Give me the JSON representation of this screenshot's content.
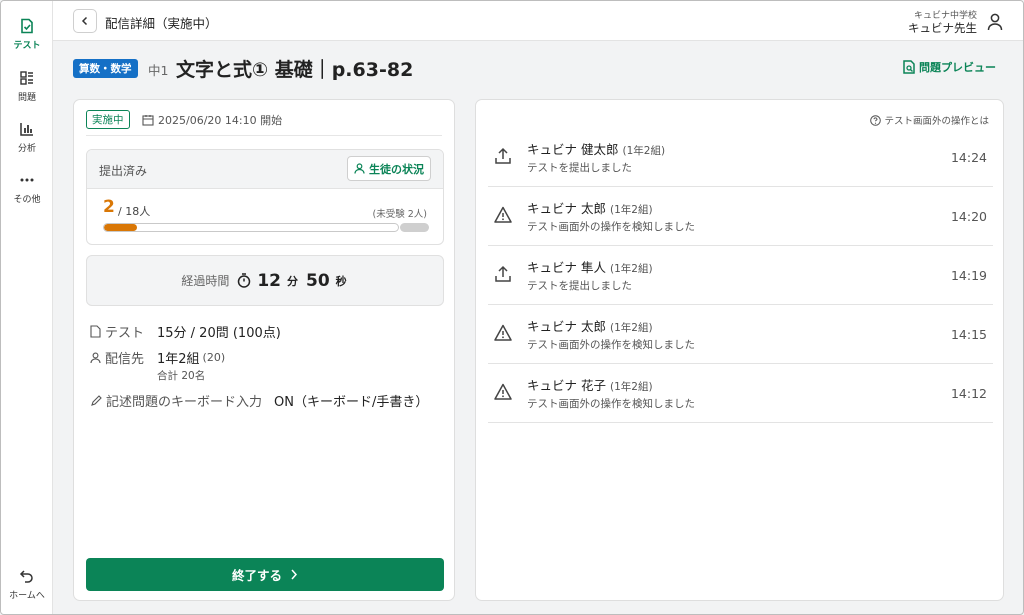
{
  "sidebar": {
    "items": [
      {
        "label": "テスト",
        "icon": "test-doc-icon",
        "active": true
      },
      {
        "label": "問題",
        "icon": "question-list-icon",
        "active": false
      },
      {
        "label": "分析",
        "icon": "bar-chart-icon",
        "active": false
      },
      {
        "label": "その他",
        "icon": "more-dots-icon",
        "active": false
      }
    ],
    "home_label": "ホームへ"
  },
  "header": {
    "title": "配信詳細（実施中）",
    "school": "キュビナ中学校",
    "teacher": "キュビナ先生"
  },
  "page": {
    "subject_badge": "算数・数学",
    "grade": "中1",
    "title": "文字と式① 基礎｜p.63-82",
    "preview_label": "問題プレビュー"
  },
  "left_card": {
    "status_badge": "実施中",
    "date": "2025/06/20 14:10 開始",
    "submitted_label": "提出済み",
    "student_status_label": "生徒の状況",
    "submitted_count": "2",
    "total_label": "/ 18人",
    "pending_label": "(未受験 2人)",
    "progress_fraction": 0.111,
    "elapsed_label": "経過時間",
    "elapsed_min": "12",
    "elapsed_min_unit": "分",
    "elapsed_sec": "50",
    "elapsed_sec_unit": "秒",
    "test_label": "テスト",
    "test_value": "15分 / 20問 (100点)",
    "dest_label": "配信先",
    "dest_value": "1年2組",
    "dest_count": "(20)",
    "dest_total": "合計 20名",
    "keyboard_label": "記述問題のキーボード入力",
    "keyboard_value": "ON（キーボード/手書き）",
    "end_button": "終了する"
  },
  "right_card": {
    "help_link": "テスト画面外の操作とは",
    "logs": [
      {
        "name": "キュビナ 健太郎",
        "class": "(1年2組)",
        "message": "テストを提出しました",
        "time": "14:24",
        "icon": "upload-icon"
      },
      {
        "name": "キュビナ 太郎",
        "class": "(1年2組)",
        "message": "テスト画面外の操作を検知しました",
        "time": "14:20",
        "icon": "warning-icon"
      },
      {
        "name": "キュビナ 隼人",
        "class": "(1年2組)",
        "message": "テストを提出しました",
        "time": "14:19",
        "icon": "upload-icon"
      },
      {
        "name": "キュビナ 太郎",
        "class": "(1年2組)",
        "message": "テスト画面外の操作を検知しました",
        "time": "14:15",
        "icon": "warning-icon"
      },
      {
        "name": "キュビナ 花子",
        "class": "(1年2組)",
        "message": "テスト画面外の操作を検知しました",
        "time": "14:12",
        "icon": "warning-icon"
      }
    ]
  },
  "colors": {
    "accent_green": "#0b8457",
    "subject_blue": "#1570c6",
    "progress_orange": "#d97706"
  }
}
